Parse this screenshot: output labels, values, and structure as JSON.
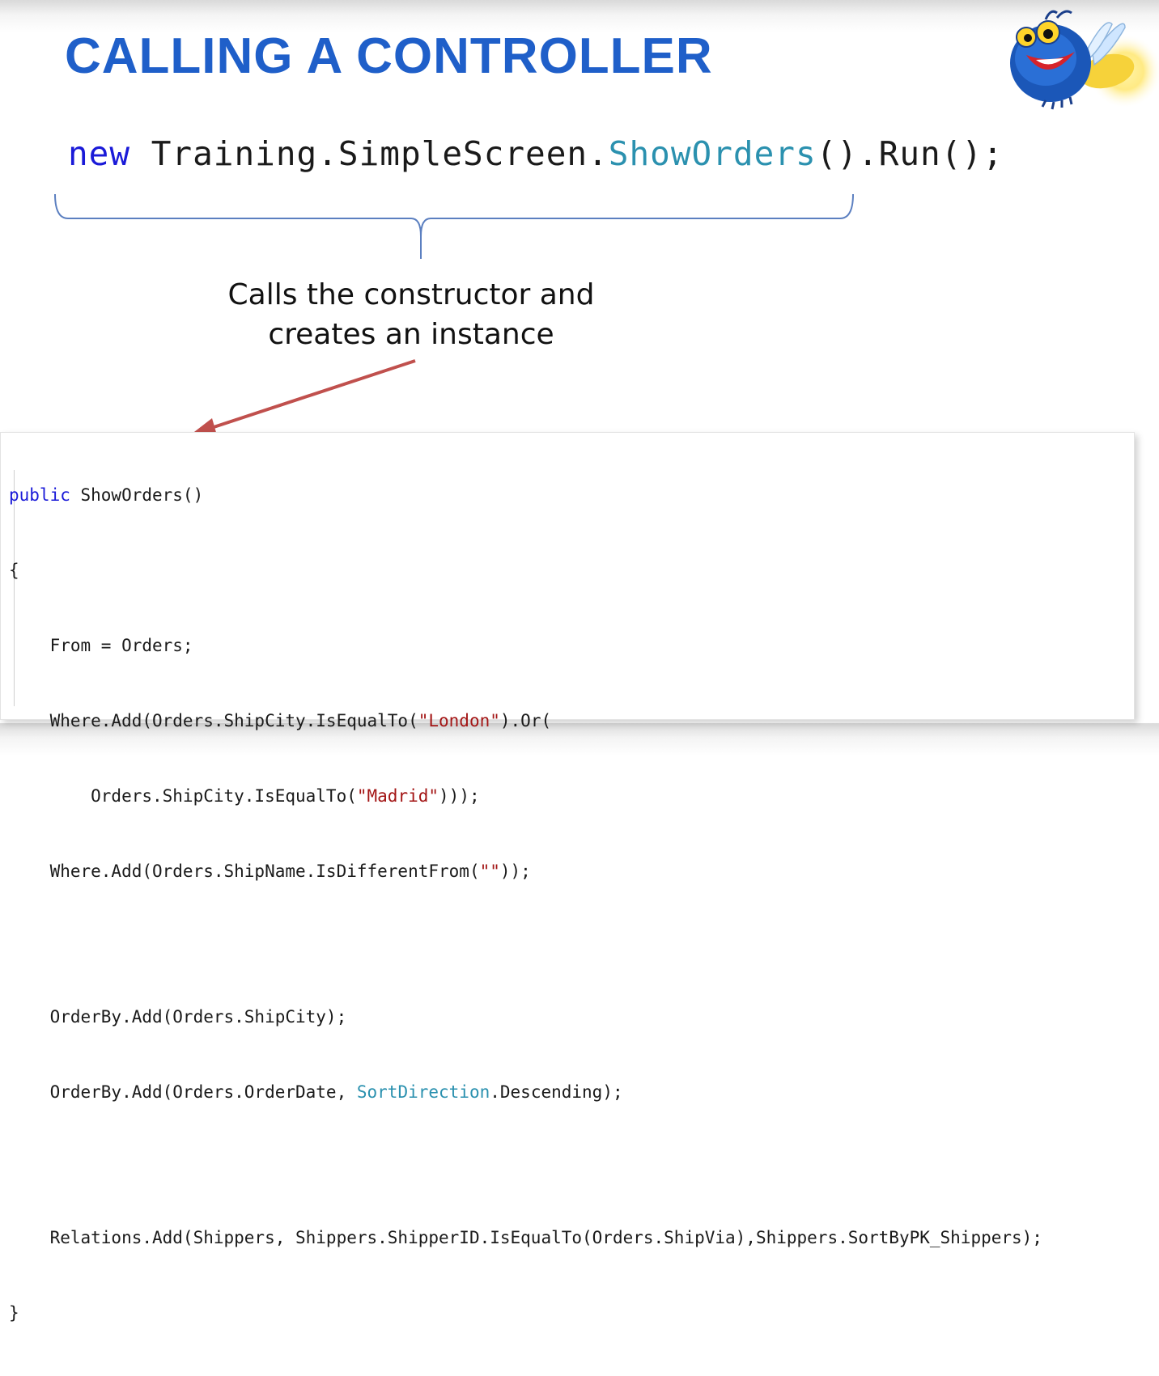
{
  "slide": {
    "title": "CALLING A CONTROLLER"
  },
  "call": {
    "keyword": "new",
    "prefix": " Training.SimpleScreen.",
    "class_name": "ShowOrders",
    "suffix": "().Run();"
  },
  "caption": {
    "line1": "Calls the constructor and",
    "line2": "creates an instance"
  },
  "code": {
    "l1_keyword": "public",
    "l1_rest": " ShowOrders()",
    "l2": "{",
    "l3": "    From = Orders;",
    "l4_a": "    Where.Add(Orders.ShipCity.IsEqualTo(",
    "l4_str": "\"London\"",
    "l4_b": ").Or(",
    "l5_a": "        Orders.ShipCity.IsEqualTo(",
    "l5_str": "\"Madrid\"",
    "l5_b": ")));",
    "l6_a": "    Where.Add(Orders.ShipName.IsDifferentFrom(",
    "l6_str": "\"\"",
    "l6_b": "));",
    "l7": "    OrderBy.Add(Orders.ShipCity);",
    "l8_a": "    OrderBy.Add(Orders.OrderDate, ",
    "l8_type": "SortDirection",
    "l8_b": ".Descending);",
    "l9": "    Relations.Add(Shippers, Shippers.ShipperID.IsEqualTo(Orders.ShipVia),Shippers.SortByPK_Shippers);",
    "l10": "}"
  },
  "colors": {
    "title": "#1f5fc9",
    "keyword": "#1a1ad8",
    "type": "#2b91af",
    "string": "#a31515",
    "brace": "#5b7fc0",
    "arrow": "#c0504d"
  },
  "icons": {
    "mascot": "firefly-mascot-logo"
  }
}
